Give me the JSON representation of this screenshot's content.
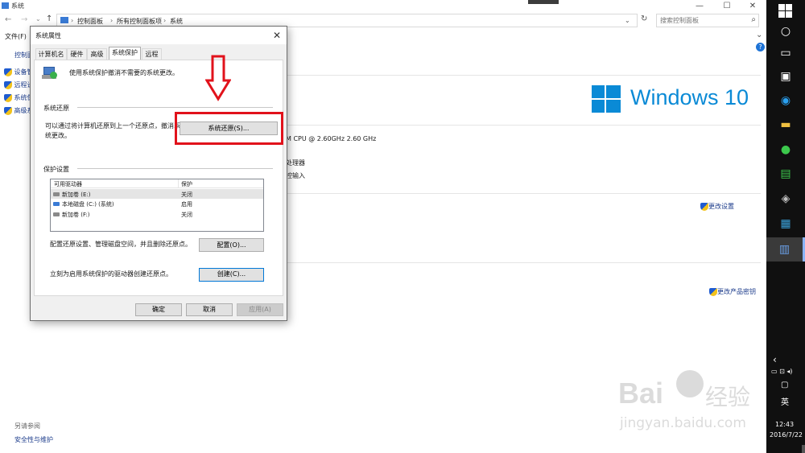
{
  "window": {
    "title": "系统",
    "controls": [
      "—",
      "☐",
      "✕"
    ],
    "address_segments": [
      "控制面板",
      "所有控制面板项",
      "系统"
    ],
    "search_placeholder": "搜索控制面板",
    "menu_file": "文件(F)",
    "left_nav": {
      "home": "控制面",
      "items": [
        "设备管",
        "远程设",
        "系统保",
        "高级系"
      ]
    },
    "windows_logo_text": "Windows 10",
    "cpu_text": "M CPU @ 2.60GHz   2.60 GHz",
    "processor_text": "处理器",
    "touch_text": "控输入",
    "change_settings": "更改设置",
    "change_key": "更改产品密钥",
    "see_also": "另请参阅",
    "security_link": "安全性与维护"
  },
  "taskbar": {
    "time": "12:43",
    "date": "2016/7/22",
    "ime": "英"
  },
  "dialog": {
    "title": "系统属性",
    "tabs": [
      "计算机名",
      "硬件",
      "高级",
      "系统保护",
      "远程"
    ],
    "active_tab": "系统保护",
    "intro": "使用系统保护撤消不需要的系统更改。",
    "restore_group": "系统还原",
    "restore_desc_1": "可以通过将计算机还原到上一个还原点，撤消系",
    "restore_desc_2": "统更改。",
    "restore_button": "系统还原(S)...",
    "protection_group": "保护设置",
    "list_headers": [
      "可用驱动器",
      "保护"
    ],
    "drives": [
      {
        "name": "新加卷 (E:)",
        "status": "关闭"
      },
      {
        "name": "本地磁盘 (C:) (系统)",
        "status": "启用"
      },
      {
        "name": "新加卷 (F:)",
        "status": "关闭"
      }
    ],
    "config_desc": "配置还原设置、管理磁盘空间，并且删除还原点。",
    "config_button": "配置(O)...",
    "create_desc": "立刻为启用系统保护的驱动器创建还原点。",
    "create_button": "创建(C)...",
    "ok": "确定",
    "cancel": "取消",
    "apply": "应用(A)"
  },
  "watermark": {
    "line1": "Bai",
    "line2": "经验",
    "url": "jingyan.baidu.com"
  },
  "colors": {
    "accent": "#0078d7",
    "highlight": "#e1121b",
    "taskbar": "#101010"
  }
}
